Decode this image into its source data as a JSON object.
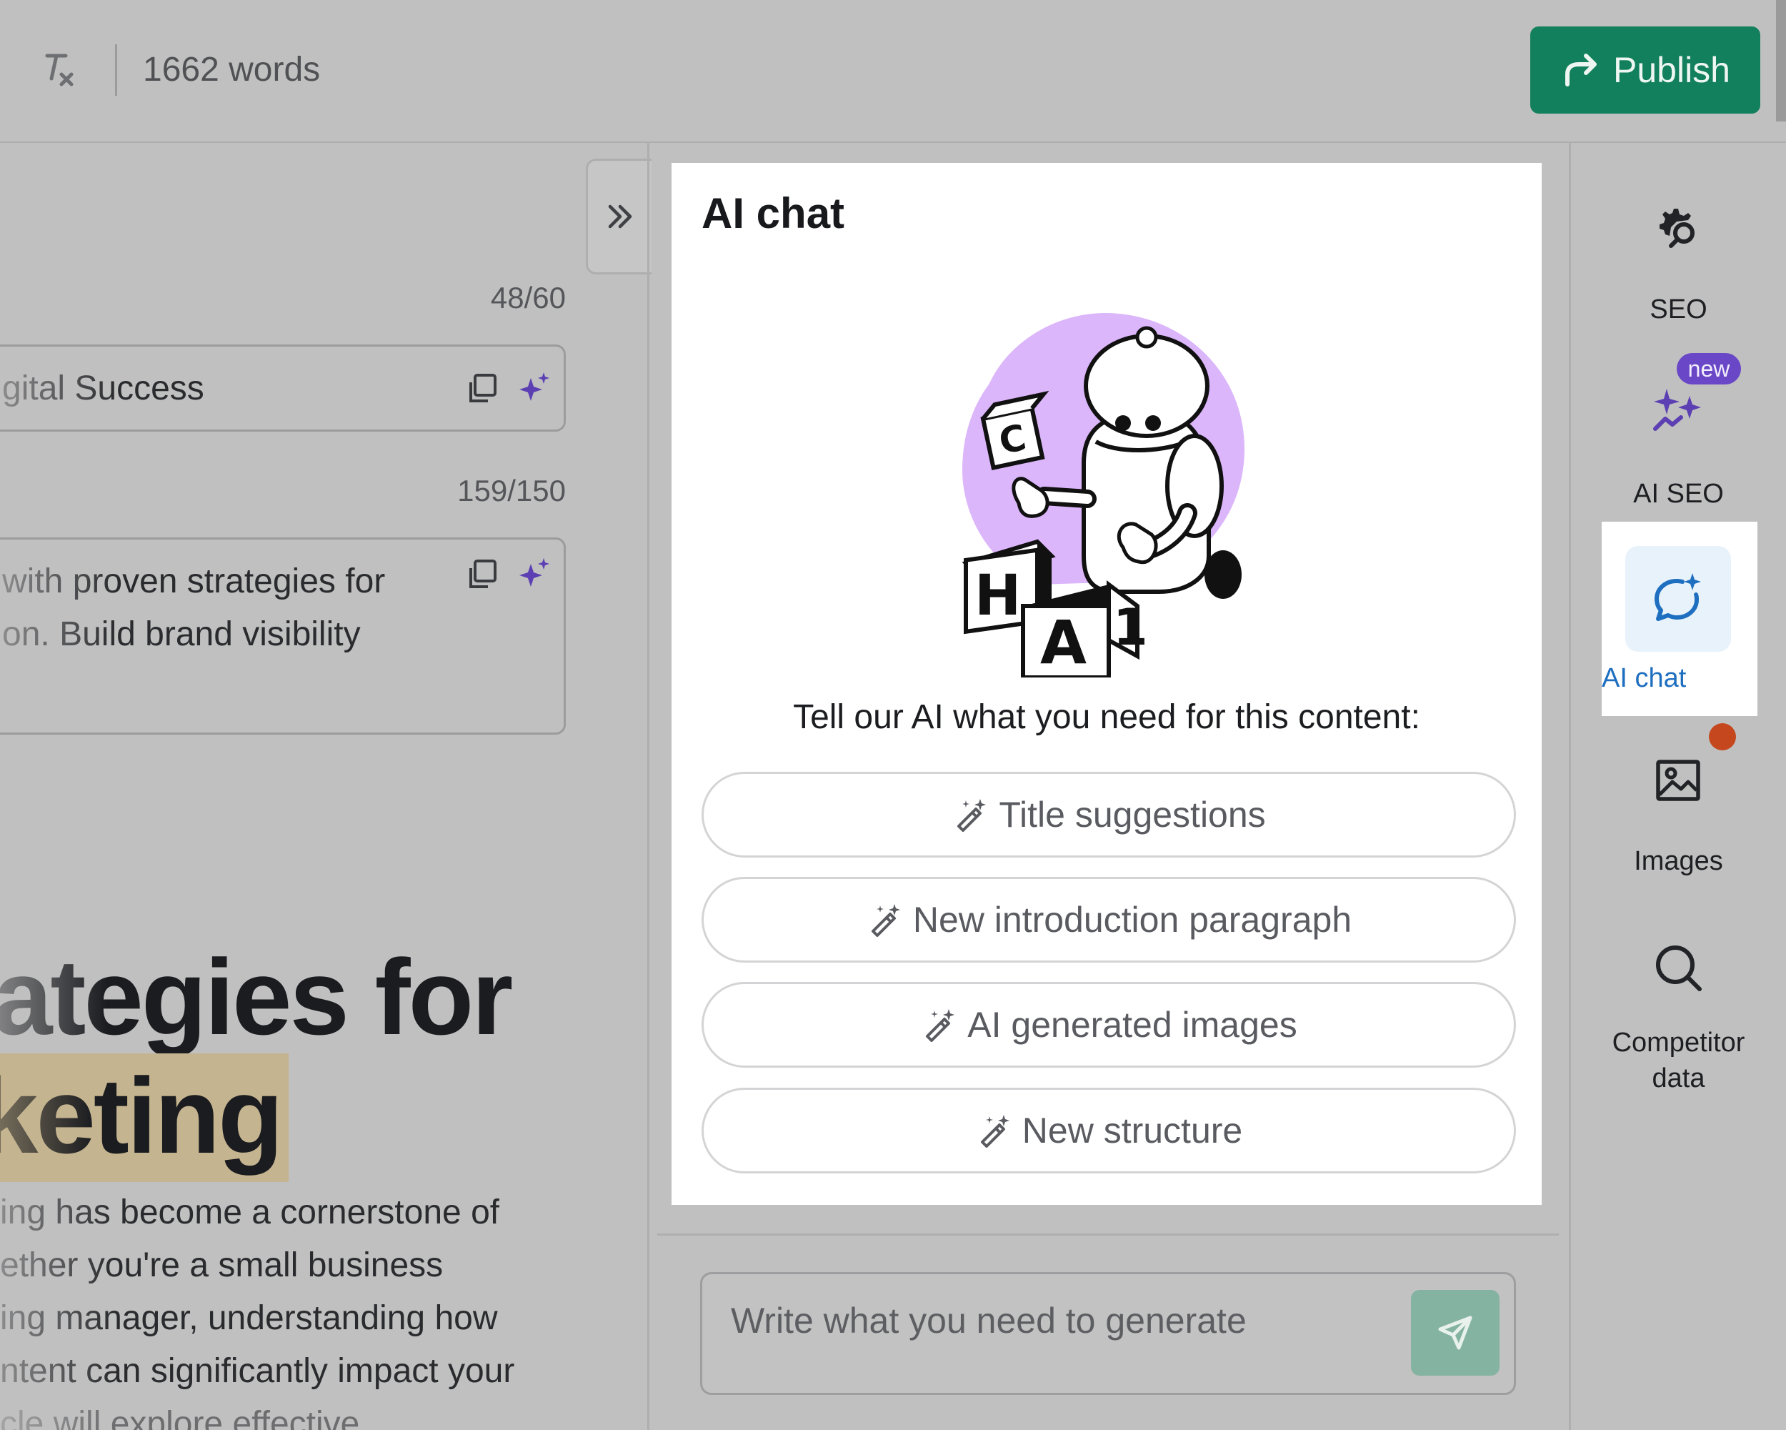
{
  "topbar": {
    "word_count": "1662 words",
    "publish_label": "Publish"
  },
  "editor": {
    "title_counter": "48/60",
    "meta_title": "gital Success",
    "desc_counter": "159/150",
    "meta_description_lines": [
      "with proven strategies for",
      "on. Build brand visibility"
    ],
    "headline_lines": [
      "ategies for",
      "keting"
    ],
    "body_lines": [
      "ing has become a cornerstone of",
      "ether you're a small business",
      "ing manager, understanding how",
      "ntent can significantly impact your",
      "cle will explore effective"
    ]
  },
  "ai_chat": {
    "title": "AI chat",
    "prompt": "Tell our AI what you need for this content:",
    "suggestions": [
      {
        "label": "Title suggestions"
      },
      {
        "label": "New introduction paragraph"
      },
      {
        "label": "AI generated images"
      },
      {
        "label": "New structure"
      }
    ],
    "input_placeholder": "Write what you need to generate"
  },
  "sidebar": {
    "items": [
      {
        "label": "SEO",
        "icon": "seo-gear-search-icon"
      },
      {
        "label": "AI SEO",
        "icon": "sparkles-icon",
        "badge": "new"
      },
      {
        "label": "AI chat",
        "icon": "chat-sparkle-icon",
        "active": true
      },
      {
        "label": "Images",
        "icon": "image-icon"
      },
      {
        "label": "Competitor",
        "label2": "data",
        "icon": "magnifier-icon"
      }
    ]
  },
  "colors": {
    "publish_green": "#13805d",
    "accent_purple": "#6a47c7",
    "active_blue": "#1f6fc0",
    "notification_orange": "#c5471e",
    "overlay_gray": "#c0c0c0"
  }
}
